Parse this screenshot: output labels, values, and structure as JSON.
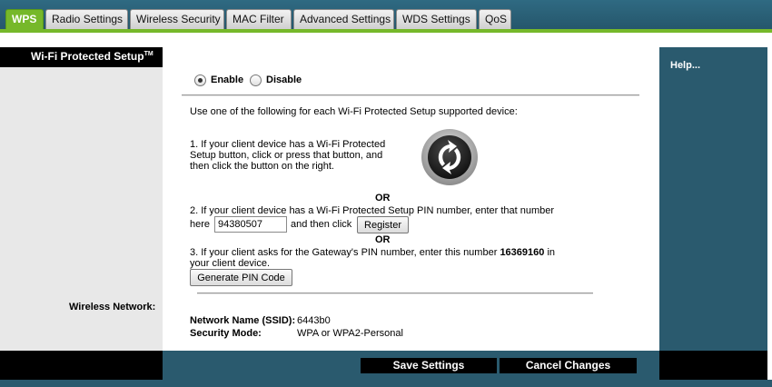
{
  "tabs": [
    {
      "label": "WPS",
      "active": true
    },
    {
      "label": "Radio Settings",
      "active": false
    },
    {
      "label": "Wireless Security",
      "active": false
    },
    {
      "label": "MAC Filter",
      "active": false
    },
    {
      "label": "Advanced Settings",
      "active": false
    },
    {
      "label": "WDS Settings",
      "active": false
    },
    {
      "label": "QoS",
      "active": false
    }
  ],
  "sidebar": {
    "title": "Wi-Fi Protected Setup",
    "title_tm": "TM",
    "wireless_network_label": "Wireless Network:"
  },
  "help": {
    "label": "Help..."
  },
  "wps": {
    "enable_label": "Enable",
    "disable_label": "Disable",
    "selected": "Enable",
    "intro": "Use one of the following for each Wi-Fi Protected Setup supported device:",
    "step1_line1": "1. If your client device has a Wi-Fi Protected",
    "step1_line2": "Setup button, click or press that button, and",
    "step1_line3": "then click the button on the right.",
    "or1": "OR",
    "step2_line1": "2. If your client device has a Wi-Fi Protected Setup PIN number, enter that number",
    "step2_here": "here",
    "pin_value": "94380507",
    "step2_then": "and then click",
    "register_label": "Register",
    "or2": "OR",
    "step3_prefix": "3. If your client asks for the Gateway's PIN number, enter this number",
    "gateway_pin": "16369160",
    "step3_suffix": "in",
    "step3_line2": "your client device.",
    "generate_label": "Generate PIN Code"
  },
  "network": {
    "ssid_label": "Network Name (SSID):",
    "ssid_value": "6443b0",
    "security_label": "Security Mode:",
    "security_value": "WPA or WPA2-Personal"
  },
  "actions": {
    "save_label": "Save Settings",
    "cancel_label": "Cancel Changes"
  },
  "colors": {
    "accent_green": "#76b82a",
    "panel_teal": "#2a5a6e",
    "bar_black": "#000000"
  }
}
